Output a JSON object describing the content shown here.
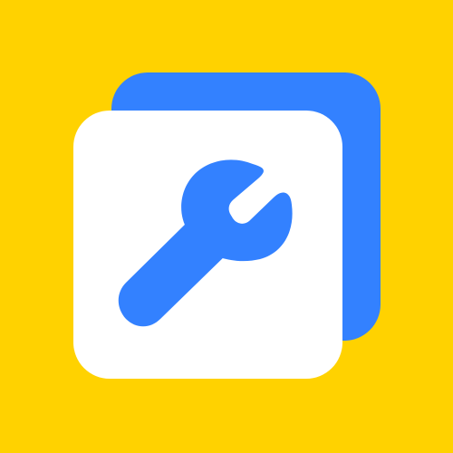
{
  "icon": {
    "name": "wrench-icon",
    "colors": {
      "background": "#FFD200",
      "back_card": "#3381FF",
      "front_card": "#FFFFFF",
      "wrench": "#3381FF"
    }
  }
}
